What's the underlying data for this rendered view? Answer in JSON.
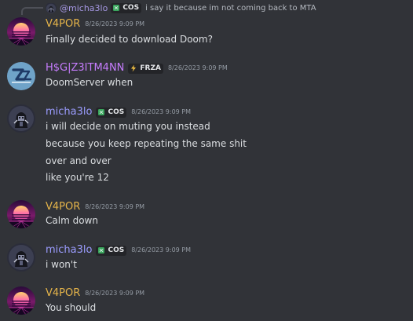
{
  "colors": {
    "background": "#313338",
    "vapor": "#e6b54a",
    "hsg": "#c77dff",
    "micha": "#9b9cff",
    "timestamp": "#949ba4",
    "text": "#dbdee1"
  },
  "reply": {
    "username": "@micha3lo",
    "badge": "COS",
    "text": "i say it because im not coming back to MTA"
  },
  "messages": [
    {
      "username": "V4POR",
      "timestamp": "8/26/2023 9:09 PM",
      "lines": [
        "Finally decided to download Doom?"
      ],
      "avatar": "synthwave-sun-avatar"
    },
    {
      "username": "H$G|Z3ITM4NN",
      "badge": "FRZA",
      "timestamp": "8/26/2023 9:09 PM",
      "lines": [
        "DoomServer when"
      ],
      "avatar": "blue-logo-avatar"
    },
    {
      "username": "micha3lo",
      "badge": "COS",
      "timestamp": "8/26/2023 9:09 PM",
      "lines": [
        "i will decide on muting you instead",
        "because you keep repeating the same shit",
        "over and over",
        "like you're 12"
      ],
      "avatar": "dark-character-avatar"
    },
    {
      "username": "V4POR",
      "timestamp": "8/26/2023 9:09 PM",
      "lines": [
        "Calm down"
      ],
      "avatar": "synthwave-sun-avatar"
    },
    {
      "username": "micha3lo",
      "badge": "COS",
      "timestamp": "8/26/2023 9:09 PM",
      "lines": [
        "i won't"
      ],
      "avatar": "dark-character-avatar"
    },
    {
      "username": "V4POR",
      "timestamp": "8/26/2023 9:09 PM",
      "lines": [
        "You should"
      ],
      "avatar": "synthwave-sun-avatar"
    }
  ]
}
